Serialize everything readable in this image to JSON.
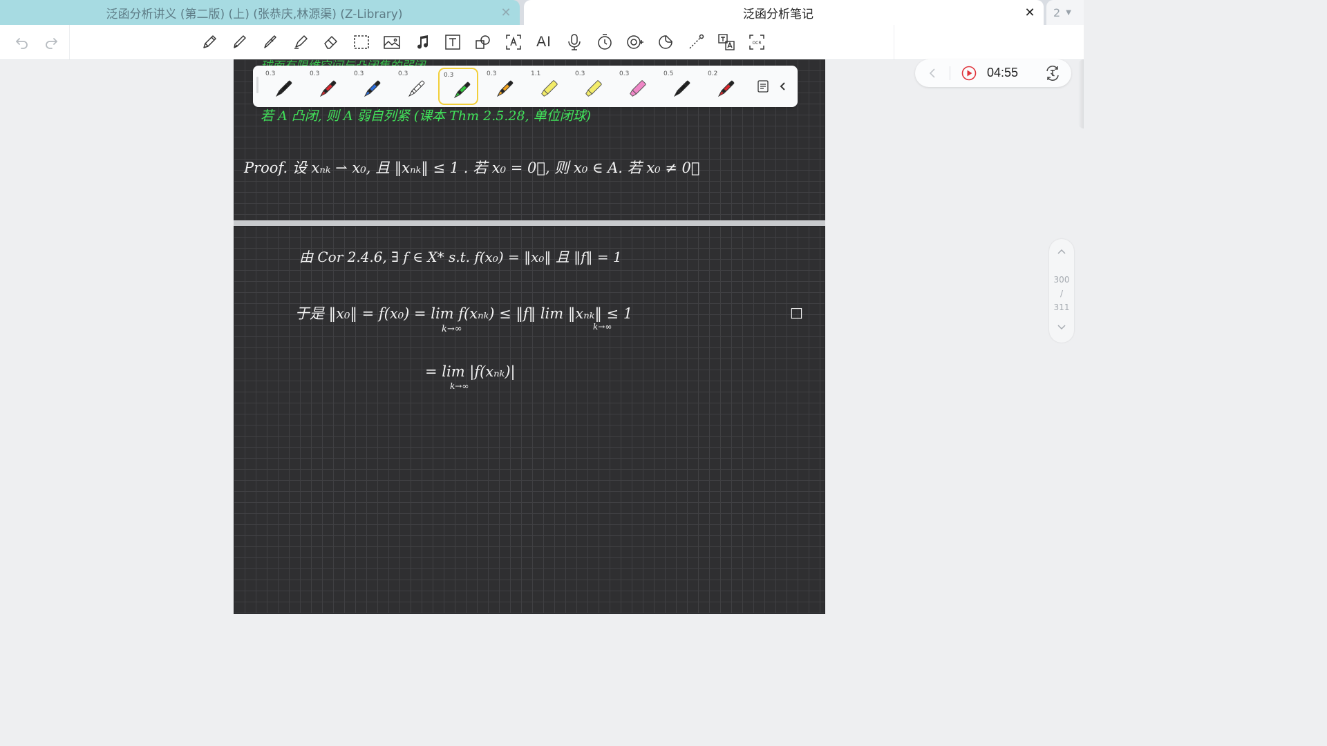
{
  "tabs": [
    {
      "title": "泛函分析讲义 (第二版) (上) (张恭庆,林源渠) (Z-Library)",
      "close": "✕"
    },
    {
      "title": "泛函分析笔记",
      "close": "✕"
    }
  ],
  "tab_count": {
    "number": "2",
    "caret": "▼"
  },
  "toolbar": {
    "ai_label": "AI",
    "tools": [
      "pencil-icon",
      "fountain-pen-icon",
      "ballpoint-pen-icon",
      "highlighter-icon",
      "eraser-icon",
      "lasso-select-icon",
      "image-icon",
      "audio-icon",
      "textbox-icon",
      "shapes-icon",
      "text-recognize-icon",
      "ai-icon",
      "microphone-icon",
      "timer-icon",
      "ruler-icon",
      "sticker-icon",
      "laser-pointer-icon",
      "translate-icon",
      "ocr-icon"
    ]
  },
  "pen_tray": {
    "pens": [
      {
        "size": "0.3",
        "color": "#1a1a1a",
        "type": "pen"
      },
      {
        "size": "0.3",
        "color": "#d8262d",
        "type": "pen"
      },
      {
        "size": "0.3",
        "color": "#2a6bd8",
        "type": "pen"
      },
      {
        "size": "0.3",
        "color": "#ffffff",
        "type": "pen"
      },
      {
        "size": "0.3",
        "color": "#32c83e",
        "type": "pen",
        "selected": true
      },
      {
        "size": "0.3",
        "color": "#f0a21e",
        "type": "pen"
      },
      {
        "size": "1.1",
        "color": "#f3ec6a",
        "type": "highlighter"
      },
      {
        "size": "0.3",
        "color": "#f3ec6a",
        "type": "highlighter"
      },
      {
        "size": "0.3",
        "color": "#ef86c6",
        "type": "highlighter"
      },
      {
        "size": "0.5",
        "color": "#1a1a1a",
        "type": "pen"
      },
      {
        "size": "0.2",
        "color": "#d8262d",
        "type": "pen"
      }
    ]
  },
  "playback": {
    "time": "04:55"
  },
  "scroller": {
    "current": "300",
    "slash": "/",
    "total": "311"
  },
  "notes": {
    "page1": {
      "green_top": "球面有限维空间与凸闭集的弱闭",
      "green_line": "若 A 凸闭,  则 A 弱自列紧  (课本 Thm 2.5.28, 单位闭球)",
      "proof_line": "Proof.  设  xₙₖ ⇀ x₀,  且 ‖xₙₖ‖ ≤ 1 .   若 x₀ = 0⃗,  则 x₀ ∈ A.  若 x₀ ≠ 0⃗"
    },
    "page2": {
      "line1": "由 Cor 2.4.6,   ∃ f ∈ X*   s.t.         f(x₀) = ‖x₀‖   且   ‖f‖ = 1",
      "line2": "于是 ‖x₀‖ = f(x₀) = lim f(xₙₖ)  ≤  ‖f‖ lim ‖xₙₖ‖  ≤ 1",
      "line2_sub_a": "k→∞",
      "line2_sub_b": "k→∞",
      "qed": "□",
      "line3": "= lim |f(xₙₖ)|",
      "line3_sub": "k→∞"
    }
  }
}
